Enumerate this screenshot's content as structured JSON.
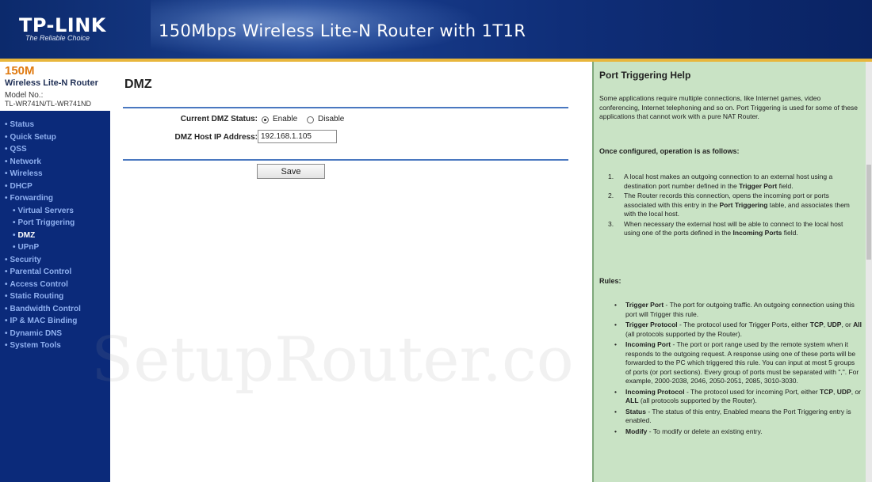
{
  "header": {
    "logo": "TP-LINK",
    "tagline": "The Reliable Choice",
    "title": "150Mbps Wireless Lite-N Router with 1T1R"
  },
  "model": {
    "main": "150M",
    "sub": "Wireless Lite-N Router",
    "label": "Model No.:",
    "value": "TL-WR741N/TL-WR741ND"
  },
  "nav": [
    {
      "label": "Status",
      "sub": false,
      "active": false
    },
    {
      "label": "Quick Setup",
      "sub": false,
      "active": false
    },
    {
      "label": "QSS",
      "sub": false,
      "active": false
    },
    {
      "label": "Network",
      "sub": false,
      "active": false
    },
    {
      "label": "Wireless",
      "sub": false,
      "active": false
    },
    {
      "label": "DHCP",
      "sub": false,
      "active": false
    },
    {
      "label": "Forwarding",
      "sub": false,
      "active": false
    },
    {
      "label": "Virtual Servers",
      "sub": true,
      "active": false
    },
    {
      "label": "Port Triggering",
      "sub": true,
      "active": false
    },
    {
      "label": "DMZ",
      "sub": true,
      "active": true
    },
    {
      "label": "UPnP",
      "sub": true,
      "active": false
    },
    {
      "label": "Security",
      "sub": false,
      "active": false
    },
    {
      "label": "Parental Control",
      "sub": false,
      "active": false
    },
    {
      "label": "Access Control",
      "sub": false,
      "active": false
    },
    {
      "label": "Static Routing",
      "sub": false,
      "active": false
    },
    {
      "label": "Bandwidth Control",
      "sub": false,
      "active": false
    },
    {
      "label": "IP & MAC Binding",
      "sub": false,
      "active": false
    },
    {
      "label": "Dynamic DNS",
      "sub": false,
      "active": false
    },
    {
      "label": "System Tools",
      "sub": false,
      "active": false
    }
  ],
  "main": {
    "title": "DMZ",
    "status_label": "Current DMZ Status:",
    "enable_label": "Enable",
    "disable_label": "Disable",
    "status_value": "Enable",
    "ip_label": "DMZ Host IP Address:",
    "ip_value": "192.168.1.105",
    "save_label": "Save"
  },
  "watermark": "SetupRouter.co",
  "help": {
    "title": "Port Triggering Help",
    "intro": "Some applications require multiple connections, like Internet games, video conferencing, Internet telephoning and so on. Port Triggering is used for some of these applications that cannot work with a pure NAT Router.",
    "operation_title": "Once configured, operation is as follows:",
    "steps": [
      {
        "num": "1.",
        "parts": [
          {
            "text": "A local host makes an outgoing connection to an external host using a destination port number defined in the ",
            "bold": false
          },
          {
            "text": "Trigger Port",
            "bold": true
          },
          {
            "text": " field.",
            "bold": false
          }
        ]
      },
      {
        "num": "2.",
        "parts": [
          {
            "text": "The Router records this connection, opens the incoming port or ports associated with this entry in the ",
            "bold": false
          },
          {
            "text": "Port Triggering",
            "bold": true
          },
          {
            "text": " table, and associates them with the local host.",
            "bold": false
          }
        ]
      },
      {
        "num": "3.",
        "parts": [
          {
            "text": "When necessary the external host will be able to connect to the local host using one of the ports defined in the ",
            "bold": false
          },
          {
            "text": "Incoming Ports",
            "bold": true
          },
          {
            "text": " field.",
            "bold": false
          }
        ]
      }
    ],
    "rules_title": "Rules:",
    "rules": [
      {
        "parts": [
          {
            "text": "Trigger Port",
            "bold": true
          },
          {
            "text": " - The port for outgoing traffic. An outgoing connection using this port will Trigger this rule.",
            "bold": false
          }
        ]
      },
      {
        "parts": [
          {
            "text": "Trigger Protocol",
            "bold": true
          },
          {
            "text": " - The protocol used for Trigger Ports, either ",
            "bold": false
          },
          {
            "text": "TCP",
            "bold": true
          },
          {
            "text": ", ",
            "bold": false
          },
          {
            "text": "UDP",
            "bold": true
          },
          {
            "text": ", or ",
            "bold": false
          },
          {
            "text": "All",
            "bold": true
          },
          {
            "text": " (all protocols supported by the Router).",
            "bold": false
          }
        ]
      },
      {
        "parts": [
          {
            "text": "Incoming Port",
            "bold": true
          },
          {
            "text": " - The port or port range used by the remote system when it responds to the outgoing request. A response using one of these ports will be forwarded to the PC which triggered this rule. You can input at most 5 groups of ports (or port sections). Every group of ports must be separated with \",\". For example, 2000-2038, 2046, 2050-2051, 2085, 3010-3030.",
            "bold": false
          }
        ]
      },
      {
        "parts": [
          {
            "text": "Incoming Protocol",
            "bold": true
          },
          {
            "text": " - The protocol used for incoming Port, either ",
            "bold": false
          },
          {
            "text": "TCP",
            "bold": true
          },
          {
            "text": ", ",
            "bold": false
          },
          {
            "text": "UDP",
            "bold": true
          },
          {
            "text": ", or ",
            "bold": false
          },
          {
            "text": "ALL",
            "bold": true
          },
          {
            "text": " (all protocols supported by the Router).",
            "bold": false
          }
        ]
      },
      {
        "parts": [
          {
            "text": "Status",
            "bold": true
          },
          {
            "text": " - The status of this entry, Enabled means the Port Triggering entry is enabled.",
            "bold": false
          }
        ]
      },
      {
        "parts": [
          {
            "text": "Modify",
            "bold": true
          },
          {
            "text": " - To modify or delete an existing entry.",
            "bold": false
          }
        ]
      }
    ]
  },
  "colors": {
    "banner": "#1a3f8f",
    "accent_strip": "#e8b63c",
    "sidebar": "#0b2a7a",
    "help_bg": "#c9e3c5",
    "rule": "#4a78c0"
  }
}
